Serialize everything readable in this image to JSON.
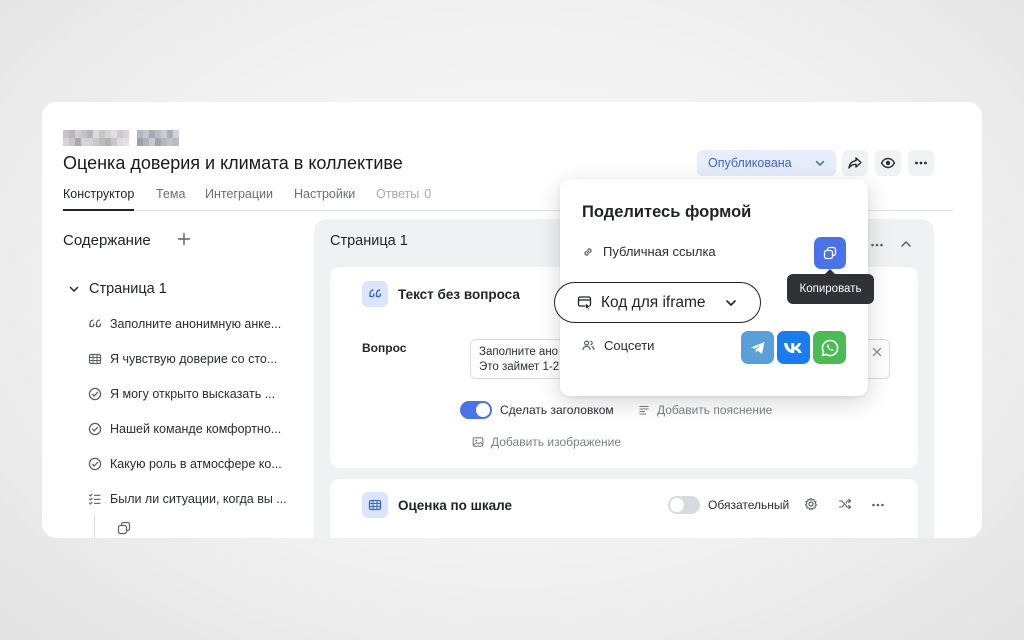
{
  "header": {
    "title": "Оценка доверия и климата в коллективе",
    "status": "Опубликована",
    "share_icon": "share-icon",
    "preview_icon": "eye-icon",
    "more_icon": "more-dots-icon"
  },
  "tabs": [
    {
      "label": "Конструктор",
      "state": "active"
    },
    {
      "label": "Тема",
      "state": "normal"
    },
    {
      "label": "Интеграции",
      "state": "normal"
    },
    {
      "label": "Настройки",
      "state": "normal"
    },
    {
      "label": "Ответы",
      "count": "0",
      "state": "disabled"
    }
  ],
  "sidebar": {
    "heading": "Содержание",
    "page": "Страница 1",
    "items": [
      {
        "icon": "quote-icon",
        "label": "Заполните анонимную анке..."
      },
      {
        "icon": "grid-icon",
        "label": "Я чувствую доверие со сто..."
      },
      {
        "icon": "check-circle-icon",
        "label": "Я могу открыто высказать ..."
      },
      {
        "icon": "check-circle-icon",
        "label": "Нашей команде комфортно..."
      },
      {
        "icon": "check-circle-icon",
        "label": "Какую роль в атмосфере ко..."
      },
      {
        "icon": "checklist-icon",
        "label": "Были ли ситуации, когда вы ..."
      }
    ]
  },
  "main": {
    "page_title": "Страница 1",
    "question1": {
      "title": "Текст без вопроса",
      "field_label": "Вопрос",
      "field_line1": "Заполните ано",
      "field_line2": "Это займет 1-2",
      "toggle_label": "Сделать заголовком",
      "toggle_on": true,
      "add_hint": "Добавить пояснение",
      "add_image": "Добавить изображение"
    },
    "question2": {
      "title": "Оценка по шкале",
      "required_label": "Обязательный",
      "required_on": false
    }
  },
  "share_popup": {
    "title": "Поделитесь формой",
    "public_link": "Публичная ссылка",
    "iframe_label": "Код для iframe",
    "socials_label": "Соцсети",
    "tooltip": "Копировать",
    "socials": [
      {
        "name": "telegram-icon",
        "color": "#5aa0d8"
      },
      {
        "name": "vk-icon",
        "color": "#1b7cf2"
      },
      {
        "name": "whatsapp-icon",
        "color": "#4dbb55"
      }
    ]
  },
  "colors": {
    "accent": "#4a73e8",
    "status_bg": "#e6edfb",
    "status_text": "#3d67c9"
  }
}
